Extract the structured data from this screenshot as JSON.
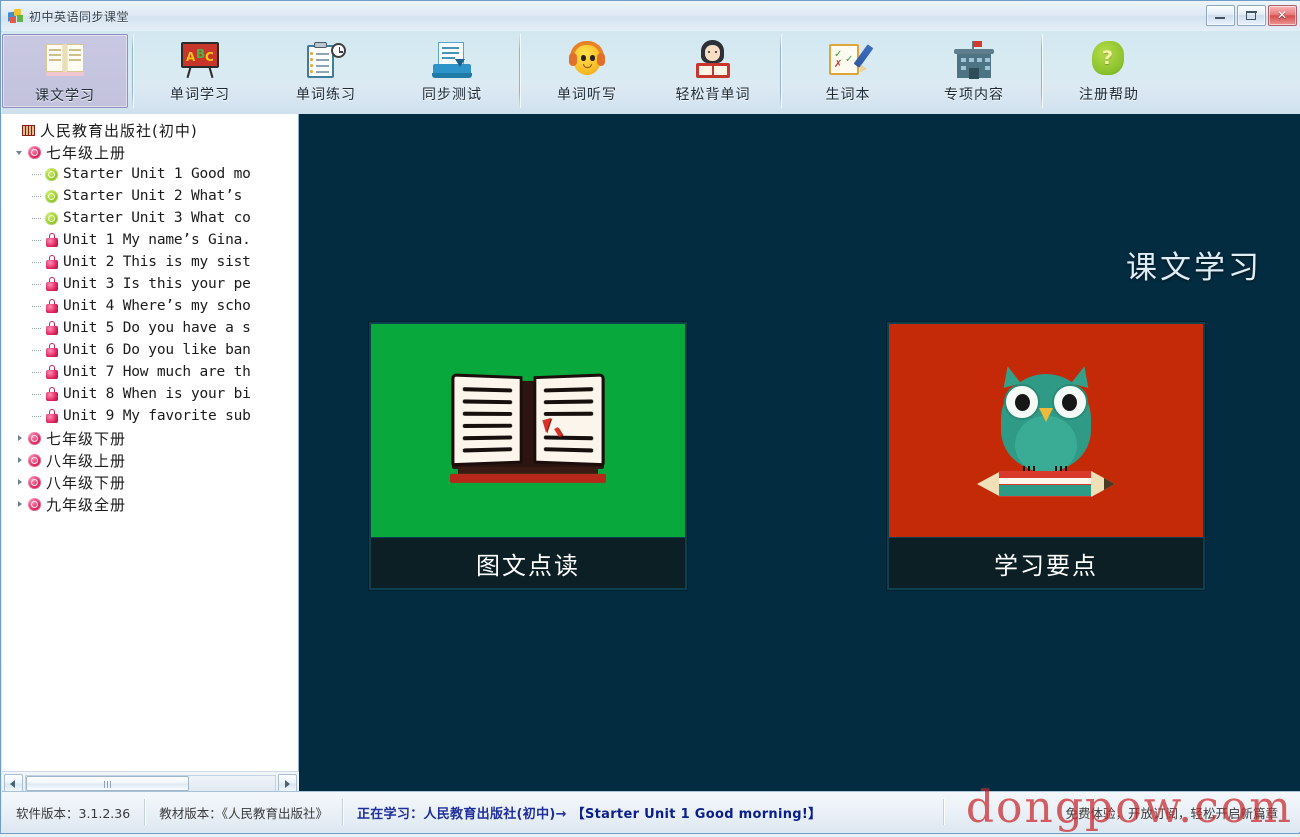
{
  "window": {
    "title": "初中英语同步课堂",
    "icon": "app-logo-icon",
    "minimize_label": "",
    "maximize_label": "",
    "close_label": "✕"
  },
  "toolbar": {
    "groups": [
      {
        "items": [
          {
            "label": "课文学习",
            "icon": "open-book-icon",
            "active": true
          }
        ]
      },
      {
        "items": [
          {
            "label": "单词学习",
            "icon": "blackboard-abc-icon",
            "active": false
          },
          {
            "label": "单词练习",
            "icon": "clipboard-clock-icon",
            "active": false
          },
          {
            "label": "同步测试",
            "icon": "laptop-test-icon",
            "active": false
          }
        ]
      },
      {
        "items": [
          {
            "label": "单词听写",
            "icon": "headphone-smiley-icon",
            "active": false
          },
          {
            "label": "轻松背单词",
            "icon": "girl-reading-icon",
            "active": false
          }
        ]
      },
      {
        "items": [
          {
            "label": "生词本",
            "icon": "notepad-pen-icon",
            "active": false
          },
          {
            "label": "专项内容",
            "icon": "school-building-icon",
            "active": false
          }
        ]
      },
      {
        "items": [
          {
            "label": "注册帮助",
            "icon": "green-head-question-icon",
            "active": false
          }
        ]
      }
    ]
  },
  "tree": {
    "nodes": [
      {
        "label": "人民教育出版社(初中)",
        "icon": "publisher-icon",
        "level": 0,
        "expander": "none",
        "cjk": true
      },
      {
        "label": "七年级上册",
        "icon": "grade-open-icon",
        "level": 1,
        "expander": "open",
        "cjk": true
      },
      {
        "label": "Starter Unit 1 Good mo",
        "icon": "unlocked-green-icon",
        "level": 2,
        "expander": "leaf",
        "cjk": false
      },
      {
        "label": "Starter Unit 2 What’s",
        "icon": "unlocked-green-icon",
        "level": 2,
        "expander": "leaf",
        "cjk": false
      },
      {
        "label": "Starter Unit 3 What co",
        "icon": "unlocked-green-icon",
        "level": 2,
        "expander": "leaf",
        "cjk": false
      },
      {
        "label": "Unit 1 My name’s Gina.",
        "icon": "locked-red-icon",
        "level": 2,
        "expander": "leaf",
        "cjk": false
      },
      {
        "label": "Unit 2 This is my sist",
        "icon": "locked-red-icon",
        "level": 2,
        "expander": "leaf",
        "cjk": false
      },
      {
        "label": "Unit 3 Is this your pe",
        "icon": "locked-red-icon",
        "level": 2,
        "expander": "leaf",
        "cjk": false
      },
      {
        "label": "Unit 4 Where’s my scho",
        "icon": "locked-red-icon",
        "level": 2,
        "expander": "leaf",
        "cjk": false
      },
      {
        "label": "Unit 5 Do you have a s",
        "icon": "locked-red-icon",
        "level": 2,
        "expander": "leaf",
        "cjk": false
      },
      {
        "label": "Unit 6 Do you like ban",
        "icon": "locked-red-icon",
        "level": 2,
        "expander": "leaf",
        "cjk": false
      },
      {
        "label": "Unit 7 How much are th",
        "icon": "locked-red-icon",
        "level": 2,
        "expander": "leaf",
        "cjk": false
      },
      {
        "label": "Unit 8 When is your bi",
        "icon": "locked-red-icon",
        "level": 2,
        "expander": "leaf",
        "cjk": false
      },
      {
        "label": "Unit 9 My favorite sub",
        "icon": "locked-red-icon",
        "level": 2,
        "expander": "leaf",
        "cjk": false
      },
      {
        "label": "七年级下册",
        "icon": "grade-locked-icon",
        "level": 1,
        "expander": "collapsed",
        "cjk": true
      },
      {
        "label": "八年级上册",
        "icon": "grade-locked-icon",
        "level": 1,
        "expander": "collapsed",
        "cjk": true
      },
      {
        "label": "八年级下册",
        "icon": "grade-locked-icon",
        "level": 1,
        "expander": "collapsed",
        "cjk": true
      },
      {
        "label": "九年级全册",
        "icon": "grade-locked-icon",
        "level": 1,
        "expander": "collapsed",
        "cjk": true
      }
    ],
    "scrollbar": {
      "left_arrow": "◀",
      "right_arrow": "▶"
    }
  },
  "content": {
    "page_title": "课文学习",
    "background_color": "#042C40",
    "cards": [
      {
        "caption": "图文点读",
        "art": "open-book-pointer-art",
        "art_color": "#08A83C"
      },
      {
        "caption": "学习要点",
        "art": "owl-on-pencil-art",
        "art_color": "#C42A07"
      }
    ]
  },
  "status": {
    "software_version": "软件版本：3.1.2.36",
    "textbook_version": "教材版本：《人民教育出版社》",
    "learning_prefix": "正在学习：人民教育出版社(初中)→",
    "learning_unit": "【Starter Unit 1 Good morning!】",
    "promo": "免费体验，开放订阅，轻松开启新篇章",
    "watermark": "dongpow.com"
  }
}
